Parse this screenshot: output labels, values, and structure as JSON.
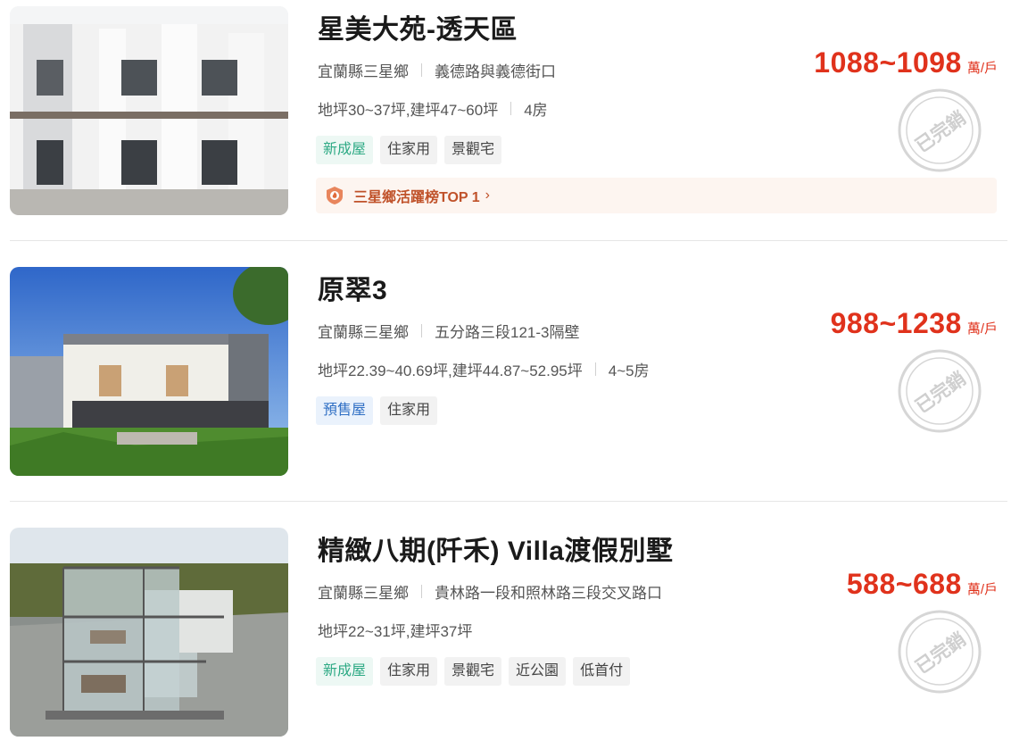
{
  "listings": [
    {
      "title": "星美大苑-透天區",
      "county": "宜蘭縣三星鄉",
      "address": "義德路與義德街口",
      "area": "地坪30~37坪,建坪47~60坪",
      "rooms": "4房",
      "tags": [
        {
          "label": "新成屋",
          "style": "green"
        },
        {
          "label": "住家用",
          "style": "gray"
        },
        {
          "label": "景觀宅",
          "style": "gray"
        }
      ],
      "rank_text": "三星鄉活躍榜TOP 1",
      "price": "1088~1098",
      "price_unit": "萬/戶",
      "status": "已完銷"
    },
    {
      "title": "原翠3",
      "county": "宜蘭縣三星鄉",
      "address": "五分路三段121-3隔壁",
      "area": "地坪22.39~40.69坪,建坪44.87~52.95坪",
      "rooms": "4~5房",
      "tags": [
        {
          "label": "預售屋",
          "style": "blue"
        },
        {
          "label": "住家用",
          "style": "gray"
        }
      ],
      "price": "988~1238",
      "price_unit": "萬/戶",
      "status": "已完銷"
    },
    {
      "title": "精緻八期(阡禾) Villa渡假別墅",
      "county": "宜蘭縣三星鄉",
      "address": "貴林路一段和照林路三段交叉路口",
      "area": "地坪22~31坪,建坪37坪",
      "tags": [
        {
          "label": "新成屋",
          "style": "green"
        },
        {
          "label": "住家用",
          "style": "gray"
        },
        {
          "label": "景觀宅",
          "style": "gray"
        },
        {
          "label": "近公園",
          "style": "gray"
        },
        {
          "label": "低首付",
          "style": "gray"
        }
      ],
      "price": "588~688",
      "price_unit": "萬/戶",
      "status": "已完銷"
    }
  ],
  "colors": {
    "price": "#e0321c",
    "green_tag": "#2eaa85",
    "blue_tag": "#2f6fc4",
    "rank": "#c0522a"
  }
}
